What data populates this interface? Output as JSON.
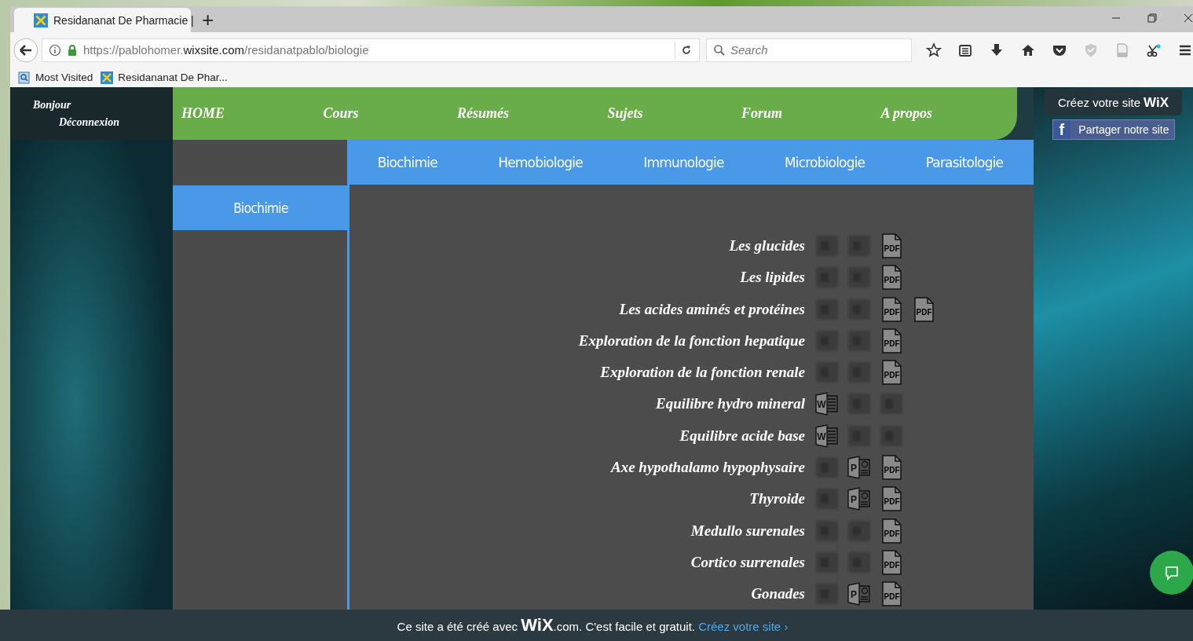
{
  "browser": {
    "tab": {
      "title": "Residananat De Pharmacie |"
    },
    "new_tab": "+",
    "url": {
      "prefix": "https://pablohomer.",
      "domain": "wixsite.com",
      "path": "/residanatpablo/biologie"
    },
    "search": {
      "placeholder": "Search"
    },
    "bookmarks": [
      "Most Visited",
      "Residananat De Phar..."
    ]
  },
  "site": {
    "account": [
      "Bonjour",
      "Déconnexion"
    ],
    "nav": [
      {
        "label": "HOME"
      },
      {
        "label": "Cours"
      },
      {
        "label": "Résumés"
      },
      {
        "label": "Sujets"
      },
      {
        "label": "Forum"
      },
      {
        "label": "A propos"
      }
    ],
    "wix_banner": {
      "text": "Créez votre site",
      "logo": "WiX"
    },
    "share": {
      "icon": "f",
      "label": "Partager notre site"
    },
    "subnav": [
      {
        "label": "Biochimie",
        "selected": false
      },
      {
        "label": "Hemobiologie",
        "selected": false
      },
      {
        "label": "Immunologie",
        "selected": false
      },
      {
        "label": "Microbiologie",
        "selected": false
      },
      {
        "label": "Parasitologie",
        "selected": false
      }
    ],
    "side_menu": [
      {
        "label": "Biochimie",
        "selected": true
      }
    ],
    "documents": [
      {
        "title": "Les glucides",
        "files": [
          {
            "kind": "word",
            "available": false
          },
          {
            "kind": "ppt",
            "available": false
          },
          {
            "kind": "pdf",
            "available": true,
            "label": "PDF"
          }
        ]
      },
      {
        "title": "Les lipides",
        "files": [
          {
            "kind": "word",
            "available": false
          },
          {
            "kind": "ppt",
            "available": false
          },
          {
            "kind": "pdf",
            "available": true,
            "label": "PDF"
          }
        ]
      },
      {
        "title": "Les acides aminés et protéines",
        "files": [
          {
            "kind": "word",
            "available": false
          },
          {
            "kind": "ppt",
            "available": false
          },
          {
            "kind": "pdf",
            "available": true,
            "label": "PDF"
          },
          {
            "kind": "pdf",
            "available": true,
            "label": "PDF"
          }
        ]
      },
      {
        "title": "Exploration de la fonction hepatique",
        "files": [
          {
            "kind": "word",
            "available": false
          },
          {
            "kind": "ppt",
            "available": false
          },
          {
            "kind": "pdf",
            "available": true,
            "label": "PDF"
          }
        ]
      },
      {
        "title": "Exploration de la fonction renale",
        "files": [
          {
            "kind": "word",
            "available": false
          },
          {
            "kind": "ppt",
            "available": false
          },
          {
            "kind": "pdf",
            "available": true,
            "label": "PDF"
          }
        ]
      },
      {
        "title": "Equilibre hydro mineral",
        "files": [
          {
            "kind": "word",
            "available": true,
            "label": "W"
          },
          {
            "kind": "ppt",
            "available": false
          },
          {
            "kind": "pdf",
            "available": false
          }
        ]
      },
      {
        "title": "Equilibre acide base",
        "files": [
          {
            "kind": "word",
            "available": true,
            "label": "W"
          },
          {
            "kind": "ppt",
            "available": false
          },
          {
            "kind": "pdf",
            "available": false
          }
        ]
      },
      {
        "title": "Axe hypothalamo hypophysaire",
        "files": [
          {
            "kind": "word",
            "available": false
          },
          {
            "kind": "ppt",
            "available": true,
            "label": "P"
          },
          {
            "kind": "pdf",
            "available": true,
            "label": "PDF"
          }
        ]
      },
      {
        "title": "Thyroide",
        "files": [
          {
            "kind": "word",
            "available": false
          },
          {
            "kind": "ppt",
            "available": true,
            "label": "P"
          },
          {
            "kind": "pdf",
            "available": true,
            "label": "PDF"
          }
        ]
      },
      {
        "title": "Medullo surenales",
        "files": [
          {
            "kind": "word",
            "available": false
          },
          {
            "kind": "ppt",
            "available": false
          },
          {
            "kind": "pdf",
            "available": true,
            "label": "PDF"
          }
        ]
      },
      {
        "title": "Cortico surrenales",
        "files": [
          {
            "kind": "word",
            "available": false
          },
          {
            "kind": "ppt",
            "available": false
          },
          {
            "kind": "pdf",
            "available": true,
            "label": "PDF"
          }
        ]
      },
      {
        "title": "Gonades",
        "files": [
          {
            "kind": "word",
            "available": false
          },
          {
            "kind": "ppt",
            "available": true,
            "label": "P"
          },
          {
            "kind": "pdf",
            "available": true,
            "label": "PDF"
          }
        ]
      }
    ],
    "footer": {
      "before": "Ce site a été créé avec",
      "logo": "WiX",
      "after": ".com. C'est facile et gratuit.",
      "link": "Créez votre site ›"
    }
  }
}
